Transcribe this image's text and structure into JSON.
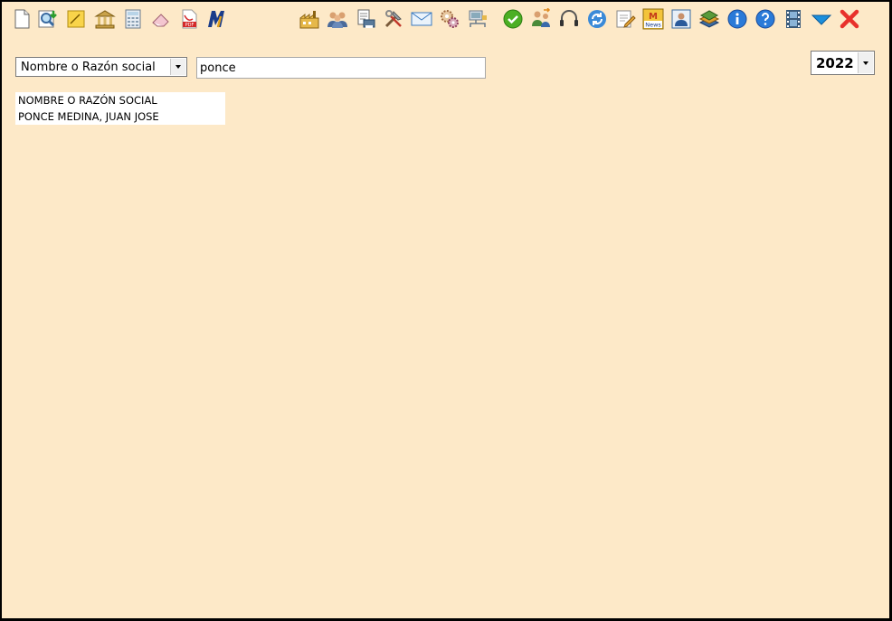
{
  "toolbar": {
    "icons": [
      "new-document-icon",
      "search-download-icon",
      "sticky-note-icon",
      "bank-icon",
      "calculator-icon",
      "eraser-icon",
      "pdf-icon",
      "brand-logo-icon",
      "factory-icon",
      "users-group-icon",
      "document-print-icon",
      "tools-icon",
      "mail-icon",
      "settings-gears-icon",
      "network-icon",
      "checkmark-icon",
      "user-transfer-icon",
      "headset-icon",
      "refresh-icon",
      "edit-note-icon",
      "news-icon",
      "contact-card-icon",
      "books-icon",
      "info-icon",
      "help-icon",
      "film-icon",
      "dropdown-arrow-icon",
      "close-icon"
    ],
    "news_label": "News",
    "pdf_label": "PDF"
  },
  "search": {
    "field_selected": "Nombre o Razón social",
    "query": "ponce"
  },
  "year": {
    "selected": "2022"
  },
  "results": {
    "header": "NOMBRE O RAZÓN SOCIAL",
    "rows": [
      "PONCE MEDINA, JUAN JOSE"
    ]
  },
  "colors": {
    "background": "#fde9c8",
    "window_border": "#000000",
    "close_red": "#e8312b",
    "arrow_blue": "#1c8fdc"
  }
}
